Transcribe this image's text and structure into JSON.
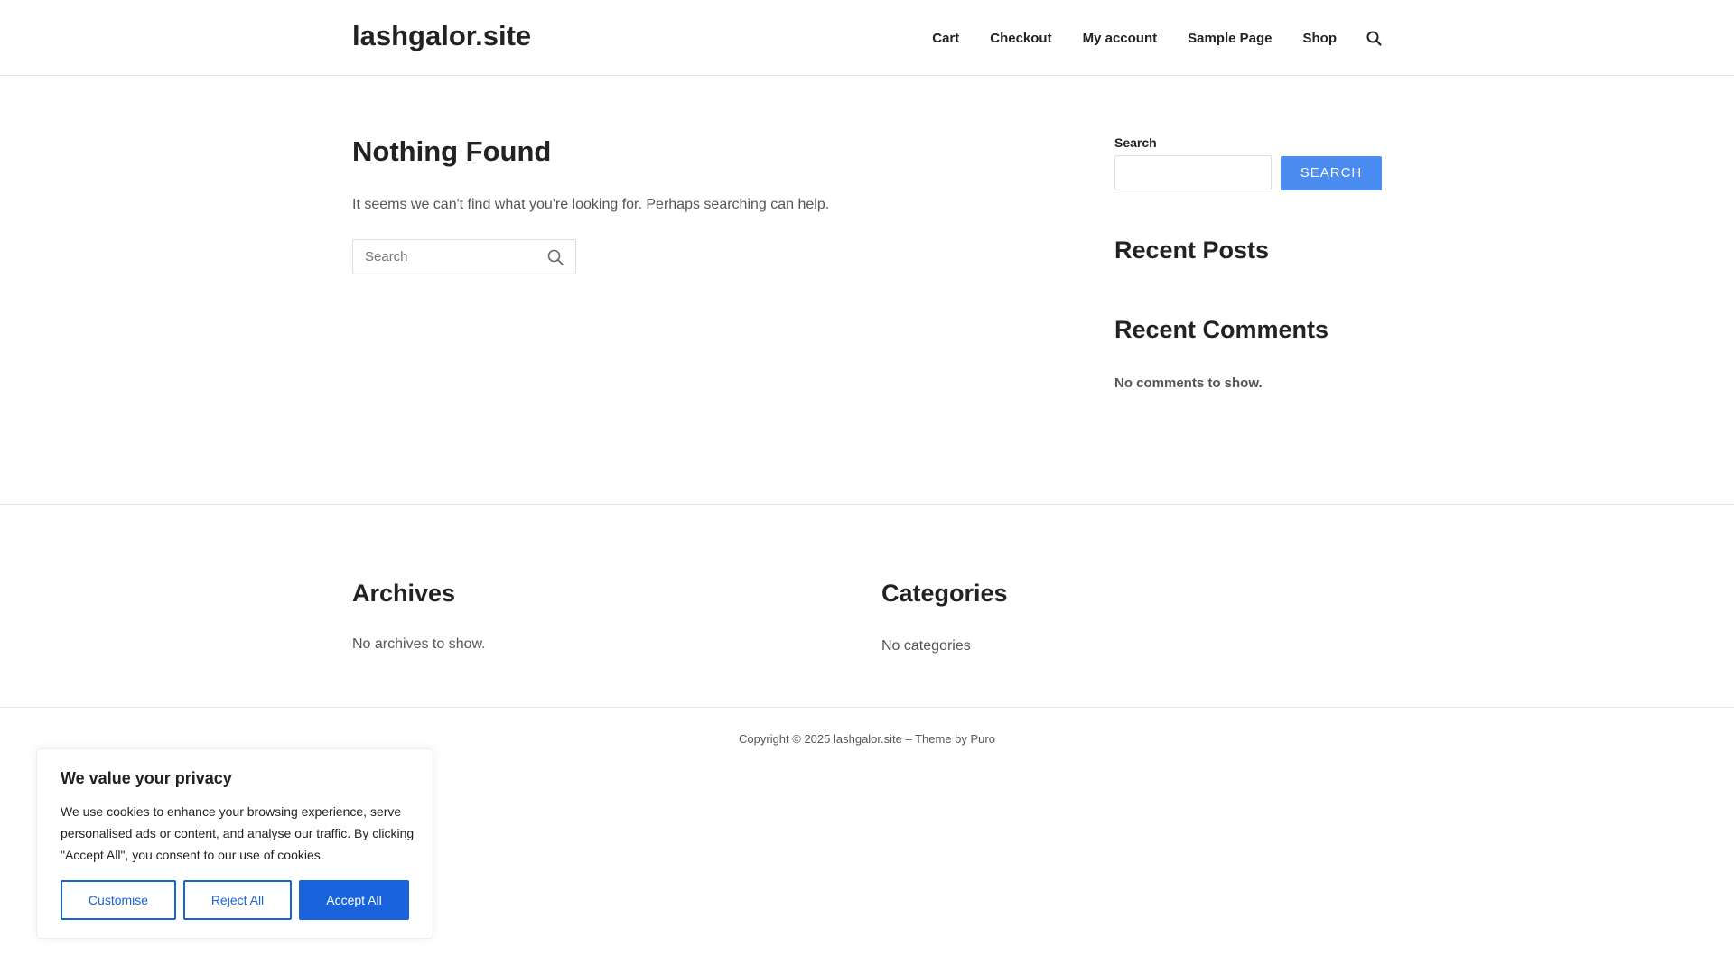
{
  "header": {
    "site_title": "lashgalor.site",
    "nav": [
      {
        "label": "Cart"
      },
      {
        "label": "Checkout"
      },
      {
        "label": "My account"
      },
      {
        "label": "Sample Page"
      },
      {
        "label": "Shop"
      }
    ],
    "search_icon": "search-icon"
  },
  "main": {
    "title": "Nothing Found",
    "description": "It seems we can't find what you're looking for. Perhaps searching can help.",
    "search": {
      "placeholder": "Search",
      "value": ""
    }
  },
  "sidebar": {
    "search_label": "Search",
    "search_value": "",
    "search_button": "SEARCH",
    "recent_posts_title": "Recent Posts",
    "recent_comments_title": "Recent Comments",
    "no_comments": "No comments to show."
  },
  "footer_widgets": {
    "archives_title": "Archives",
    "archives_text": "No archives to show.",
    "categories_title": "Categories",
    "categories_text": "No categories"
  },
  "copyright": "Copyright © 2025 lashgalor.site – Theme by Puro",
  "cookie_banner": {
    "title": "We value your privacy",
    "text": "We use cookies to enhance your browsing experience, serve personalised ads or content, and analyse our traffic. By clicking \"Accept All\", you consent to our use of cookies.",
    "customise": "Customise",
    "reject": "Reject All",
    "accept": "Accept All"
  },
  "colors": {
    "accent": "#4a8cf0",
    "cookie_primary": "#1863dc",
    "text_dark": "#222222",
    "text_muted": "#555555"
  }
}
